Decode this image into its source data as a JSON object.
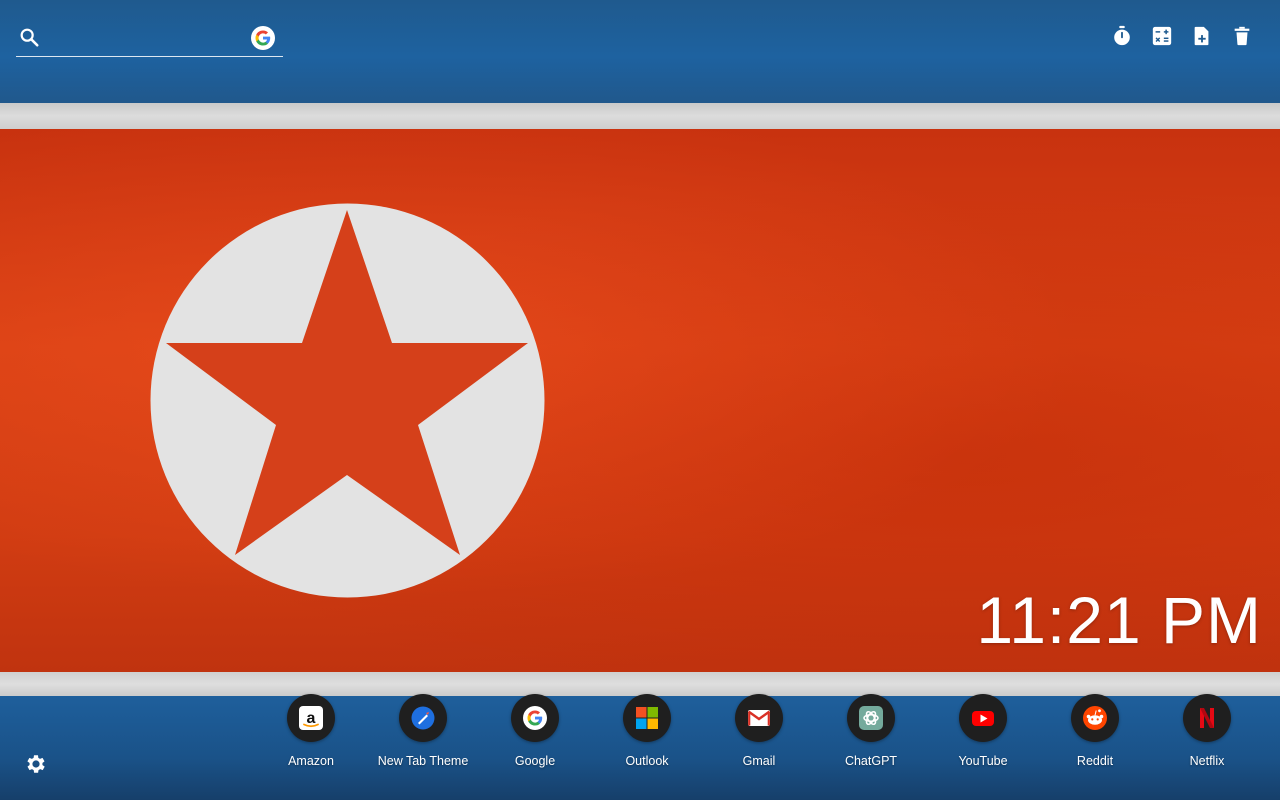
{
  "search": {
    "value": "",
    "placeholder": "",
    "search_icon": "search-icon",
    "engine_icon": "google-icon"
  },
  "toolbar": {
    "items": [
      {
        "name": "timer",
        "icon": "stopwatch-icon"
      },
      {
        "name": "calculator",
        "icon": "calculator-icon"
      },
      {
        "name": "new-note",
        "icon": "note-add-icon"
      },
      {
        "name": "delete",
        "icon": "trash-icon"
      }
    ]
  },
  "clock": {
    "time": "11:21 PM"
  },
  "shortcuts": [
    {
      "label": "Amazon",
      "icon": "amazon-icon"
    },
    {
      "label": "New Tab Theme",
      "icon": "new-tab-theme-icon"
    },
    {
      "label": "Google",
      "icon": "google-icon"
    },
    {
      "label": "Outlook",
      "icon": "microsoft-icon"
    },
    {
      "label": "Gmail",
      "icon": "gmail-icon"
    },
    {
      "label": "ChatGPT",
      "icon": "chatgpt-icon"
    },
    {
      "label": "YouTube",
      "icon": "youtube-icon"
    },
    {
      "label": "Reddit",
      "icon": "reddit-icon"
    },
    {
      "label": "Netflix",
      "icon": "netflix-icon"
    }
  ],
  "settings": {
    "icon": "gear-icon"
  },
  "colors": {
    "flag_blue": "#1e62a0",
    "flag_white": "#dcdcdc",
    "flag_red": "#d94114",
    "text": "#ffffff"
  }
}
